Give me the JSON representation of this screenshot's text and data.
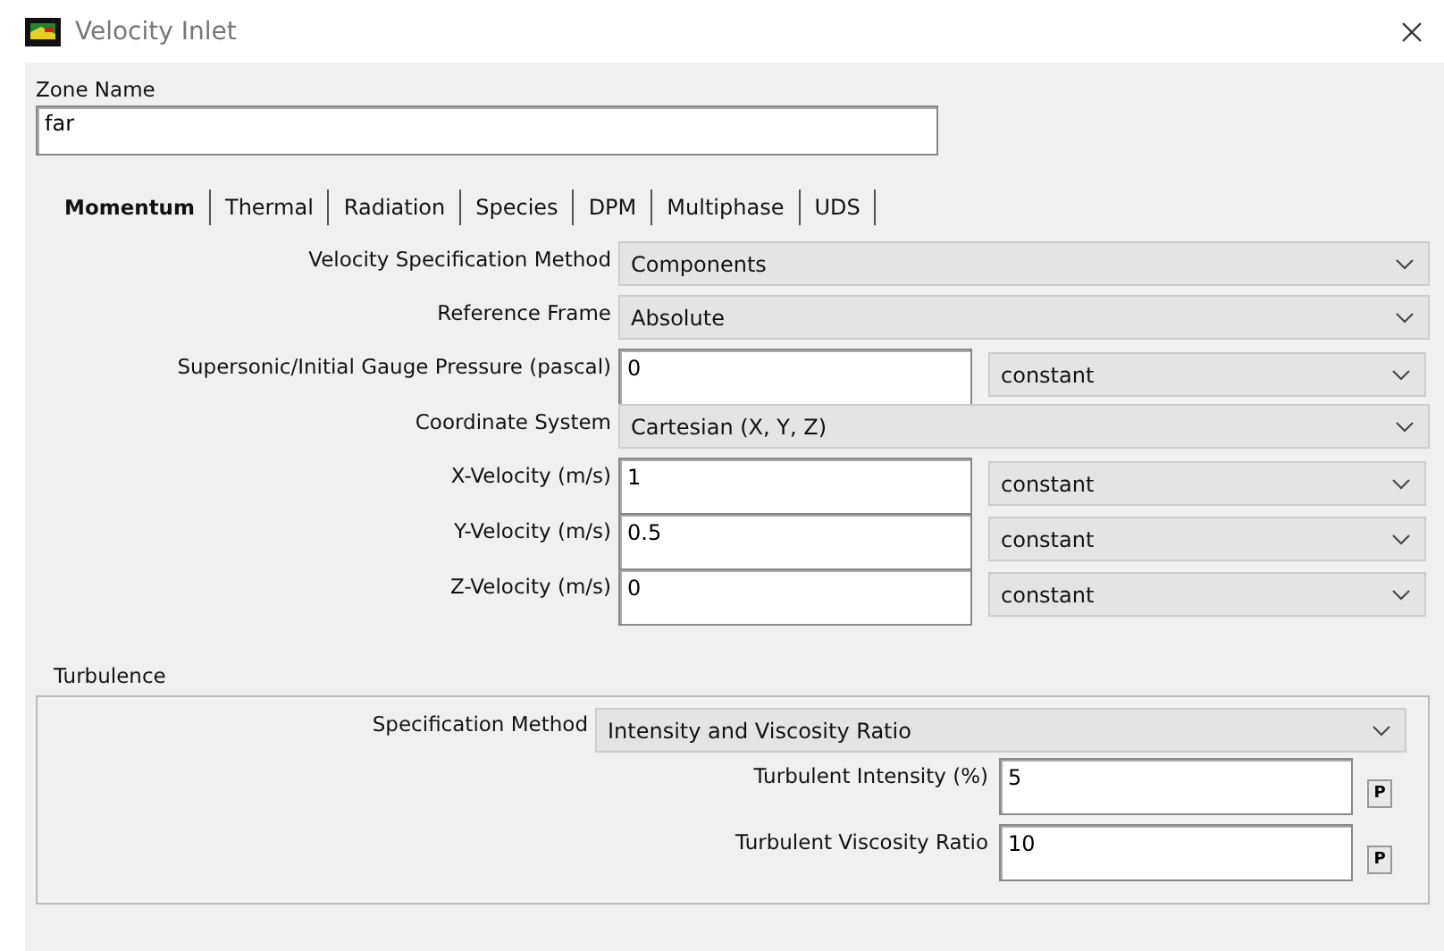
{
  "window": {
    "title": "Velocity Inlet"
  },
  "zone_name": {
    "label": "Zone Name",
    "value": "far"
  },
  "tabs": [
    {
      "label": "Momentum",
      "selected": true
    },
    {
      "label": "Thermal",
      "selected": false
    },
    {
      "label": "Radiation",
      "selected": false
    },
    {
      "label": "Species",
      "selected": false
    },
    {
      "label": "DPM",
      "selected": false
    },
    {
      "label": "Multiphase",
      "selected": false
    },
    {
      "label": "UDS",
      "selected": false
    }
  ],
  "momentum_rows": [
    {
      "kind": "dropdown",
      "label": "Velocity Specification Method",
      "value": "Components"
    },
    {
      "kind": "dropdown",
      "label": "Reference Frame",
      "value": "Absolute"
    },
    {
      "kind": "input",
      "label": "Supersonic/Initial Gauge Pressure (pascal)",
      "value": "0",
      "option": "constant"
    },
    {
      "kind": "dropdown",
      "label": "Coordinate System",
      "value": "Cartesian (X, Y, Z)"
    },
    {
      "kind": "input",
      "label": "X-Velocity (m/s)",
      "value": "1",
      "option": "constant"
    },
    {
      "kind": "input",
      "label": "Y-Velocity (m/s)",
      "value": "0.5",
      "option": "constant"
    },
    {
      "kind": "input",
      "label": "Z-Velocity (m/s)",
      "value": "0",
      "option": "constant"
    }
  ],
  "turbulence": {
    "title": "Turbulence",
    "specification_method": {
      "label": "Specification Method",
      "value": "Intensity and Viscosity Ratio"
    },
    "fields": [
      {
        "label": "Turbulent Intensity (%)",
        "value": "5",
        "button": "P"
      },
      {
        "label": "Turbulent Viscosity Ratio",
        "value": "10",
        "button": "P"
      }
    ]
  }
}
